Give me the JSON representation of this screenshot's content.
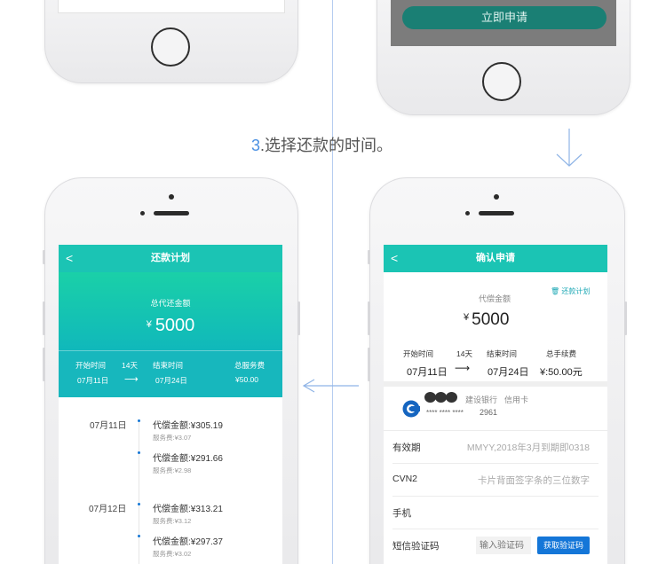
{
  "step": {
    "number": "3",
    "text": ".选择还款的时间。"
  },
  "top_right": {
    "apply_button": "立即申请"
  },
  "plan_screen": {
    "title": "还款计划",
    "back_glyph": "<",
    "total_label": "总代还金额",
    "currency": "¥",
    "total_amount": "5000",
    "period": {
      "start_label": "开始时间",
      "days": "14天",
      "end_label": "结束时间",
      "fee_label": "总服务费",
      "start_value": "07月11日",
      "arrow": "⟶",
      "end_value": "07月24日",
      "fee_value": "¥50.00"
    },
    "items": [
      {
        "date": "07月11日",
        "amount": "代偿金额:¥305.19",
        "fee": "服务费:¥3.07"
      },
      {
        "date": "",
        "amount": "代偿金额:¥291.66",
        "fee": "服务费:¥2.98"
      },
      {
        "date": "07月12日",
        "amount": "代偿金额:¥313.21",
        "fee": "服务费:¥3.12"
      },
      {
        "date": "",
        "amount": "代偿金额:¥297.37",
        "fee": "服务费:¥3.02"
      }
    ]
  },
  "confirm_screen": {
    "title": "确认申请",
    "back_glyph": "<",
    "amount_label": "代偿金额",
    "plan_link": "还款计划",
    "currency": "¥",
    "amount": "5000",
    "period": {
      "start_label": "开始时间",
      "days": "14天",
      "end_label": "结束时间",
      "fee_label": "总手续费",
      "start_value": "07月11日",
      "arrow": "⟶",
      "end_value": "07月24日",
      "fee_value": "¥:50.00元"
    },
    "card": {
      "bank": "建设银行",
      "type": "信用卡",
      "mask": "**** **** ****",
      "last4": "2961"
    },
    "fields": {
      "expiry_label": "有效期",
      "expiry_placeholder": "MMYY,2018年3月到期即0318",
      "cvn_label": "CVN2",
      "cvn_placeholder": "卡片背面签字条的三位数字",
      "phone_label": "手机",
      "sms_label": "短信验证码",
      "sms_placeholder": "输入验证码",
      "get_code": "获取验证码"
    }
  },
  "colors": {
    "teal": "#1bc4b4",
    "blue": "#1476d8",
    "link": "#4a90e2"
  }
}
